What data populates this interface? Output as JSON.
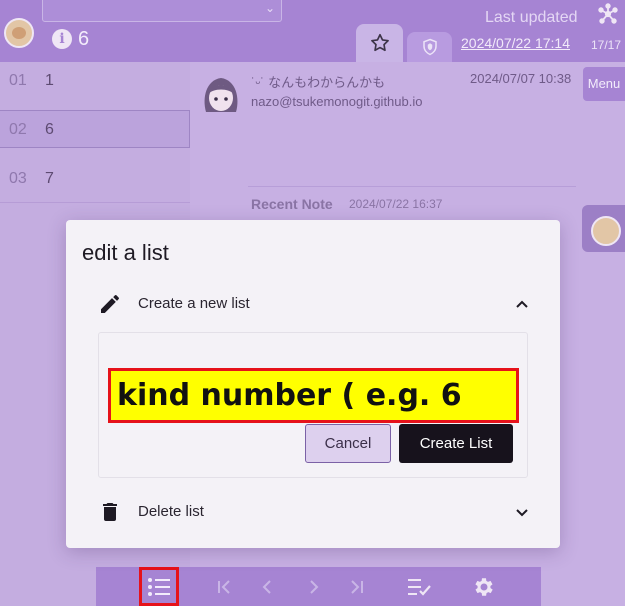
{
  "header": {
    "count": "6",
    "last_updated_label": "Last updated",
    "last_updated_date": "2024/07/22 17:14",
    "page_count": "17/17"
  },
  "lists": [
    {
      "num": "01",
      "value": "1"
    },
    {
      "num": "02",
      "value": "6"
    },
    {
      "num": "03",
      "value": "7"
    }
  ],
  "note": {
    "user_name": "˙ᵕ˙ なんもわからんかも",
    "user_email": "nazo@tsukemonogit.github.io",
    "date": "2024/07/07 10:38",
    "menu_label": "Menu",
    "recent_label": "Recent Note",
    "recent_date": "2024/07/22 16:37"
  },
  "dialog": {
    "title": "edit a list",
    "create_section_label": "Create a new list",
    "kind_input_value": "kind number ( e.g. 6",
    "cancel_label": "Cancel",
    "create_label": "Create List",
    "delete_section_label": "Delete list"
  },
  "colors": {
    "accent": "#a684d3",
    "highlight_border": "#e6121a",
    "highlight_fill": "#ffff00",
    "primary_button": "#17121c"
  }
}
